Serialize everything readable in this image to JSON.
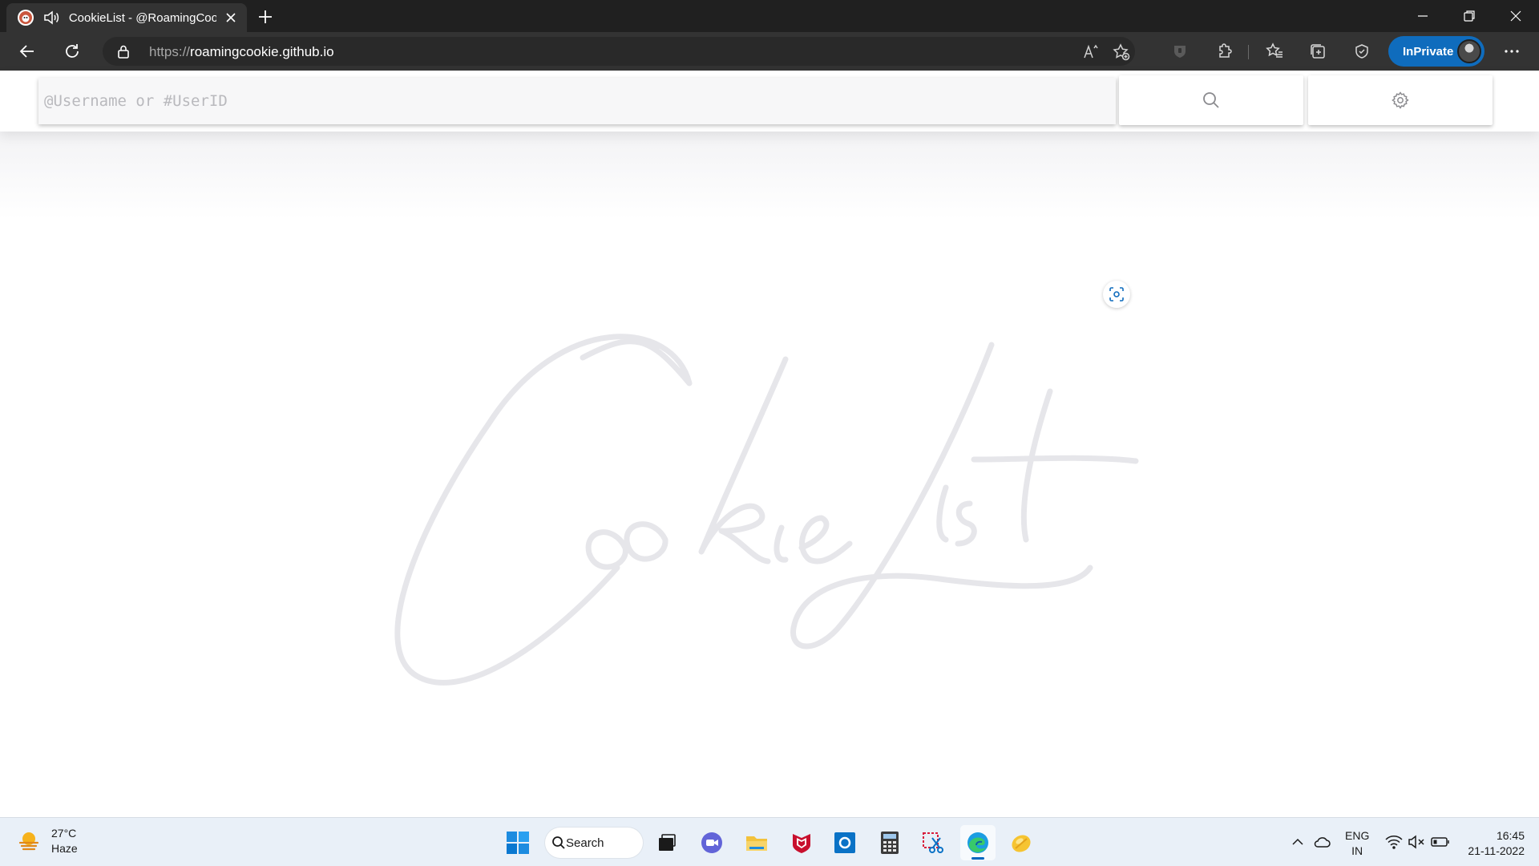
{
  "browser": {
    "tab": {
      "title": "CookieList - @RoamingCookie"
    },
    "address": {
      "scheme": "https://",
      "host": "roamingcookie.github.io"
    },
    "inprivate_label": "InPrivate",
    "icons": [
      "back-icon",
      "refresh-icon",
      "lock-icon",
      "read-aloud-icon",
      "add-favorite-icon",
      "shield-icon",
      "extensions-icon",
      "favorites-icon",
      "collections-icon",
      "performance-icon",
      "more-icon"
    ]
  },
  "page": {
    "search": {
      "placeholder": "@Username or #UserID",
      "value": ""
    },
    "logo_text": "CookieList",
    "colors": {
      "logo_stroke": "#e6e6ea",
      "header_bg": "#ffffff",
      "input_bg": "#f7f7f8"
    }
  },
  "taskbar": {
    "weather": {
      "temp": "27°C",
      "condition": "Haze"
    },
    "search_label": "Search",
    "apps": [
      "start-icon",
      "task-view-icon",
      "meet-icon",
      "file-explorer-icon",
      "mcafee-icon",
      "outlook-icon",
      "calculator-icon",
      "snipping-tool-icon",
      "edge-icon",
      "cookie-app-icon"
    ],
    "language": {
      "line1": "ENG",
      "line2": "IN"
    },
    "clock": {
      "time": "16:45",
      "date": "21-11-2022"
    }
  }
}
